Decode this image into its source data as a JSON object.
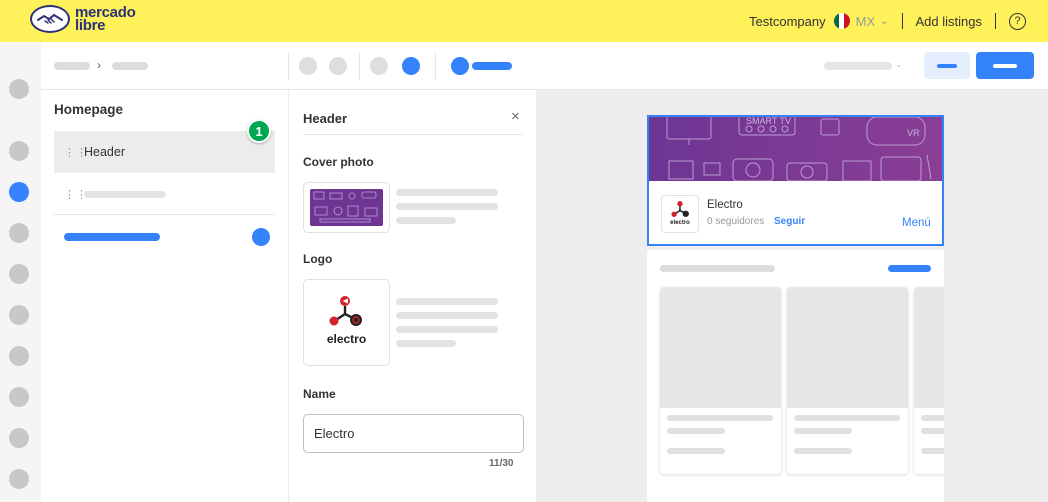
{
  "header": {
    "brand_line1": "mercado",
    "brand_line2": "libre",
    "account": "Testcompany",
    "country": "MX",
    "add_listings": "Add listings",
    "help": "?"
  },
  "sections": {
    "title": "Homepage",
    "items": [
      {
        "label": "Header",
        "selected": true
      }
    ],
    "badge": "1"
  },
  "editor": {
    "title": "Header",
    "close": "×",
    "cover_label": "Cover photo",
    "logo_label": "Logo",
    "logo_brand": "electro",
    "name_label": "Name",
    "name_value": "Electro",
    "counter": "11/30"
  },
  "preview": {
    "cover_text_1": "SMART TV",
    "cover_text_2": "VR",
    "store_name": "Electro",
    "followers": "0 seguidores",
    "follow": "Seguir",
    "menu": "Menú",
    "logo_brand": "electro"
  },
  "colors": {
    "brand_yellow": "#fff159",
    "accent_blue": "#3483fa",
    "badge_green": "#00a650",
    "cover_purple": "#7a3a96",
    "flag_green": "#006847",
    "flag_red": "#ce1126"
  }
}
